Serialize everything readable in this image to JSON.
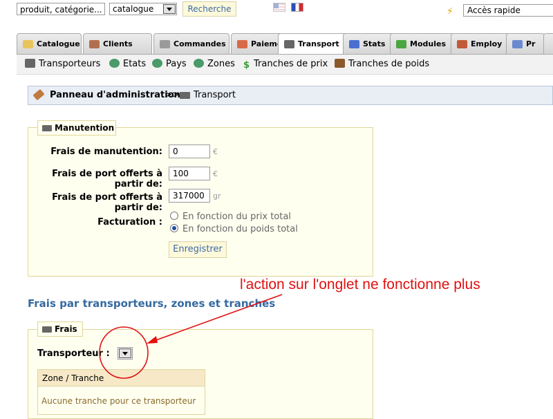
{
  "topbar": {
    "search_value": "produit, catégorie...",
    "category_select": "catalogue",
    "search_button": "Recherche",
    "flags": [
      "flag-us-icon",
      "flag-fr-icon"
    ],
    "quick_access": "Accès rapide"
  },
  "tabs": [
    {
      "label": "Catalogue",
      "icon": "folder-icon"
    },
    {
      "label": "Clients",
      "icon": "user-icon"
    },
    {
      "label": "Commandes",
      "icon": "cart-icon"
    },
    {
      "label": "Paiement",
      "icon": "payment-icon"
    },
    {
      "label": "Transport",
      "icon": "truck-icon",
      "active": true
    },
    {
      "label": "Stats",
      "icon": "chart-icon"
    },
    {
      "label": "Modules",
      "icon": "puzzle-icon"
    },
    {
      "label": "Employ",
      "icon": "employee-icon"
    },
    {
      "label": "Pr",
      "icon": "edit-icon"
    }
  ],
  "subnav": [
    {
      "label": "Transporteurs",
      "icon": "truck-icon"
    },
    {
      "label": "Etats",
      "icon": "globe-icon"
    },
    {
      "label": "Pays",
      "icon": "globe-icon"
    },
    {
      "label": "Zones",
      "icon": "globe-icon"
    },
    {
      "label": "Tranches de prix",
      "icon": "dollar-icon"
    },
    {
      "label": "Tranches de poids",
      "icon": "scale-icon"
    }
  ],
  "breadcrumb": {
    "root": "Panneau d'administration",
    "separator": ">>",
    "current": "Transport"
  },
  "handling": {
    "legend": "Manutention",
    "fields": [
      {
        "label": "Frais de manutention:",
        "value": "0",
        "unit": "€"
      },
      {
        "label_line1": "Frais de port offerts à",
        "label_line2": "partir de:",
        "value": "100",
        "unit": "€"
      },
      {
        "label_line1": "Frais de port offerts à",
        "label_line2": "partir de:",
        "value": "317000",
        "unit": "gr"
      }
    ],
    "billing_label": "Facturation :",
    "billing_options": [
      {
        "label": "En fonction du prix total",
        "checked": false
      },
      {
        "label": "En fonction du poids total",
        "checked": true
      }
    ],
    "save_button": "Enregistrer"
  },
  "fees": {
    "section_title": "Frais par transporteurs, zones et tranches",
    "legend": "Frais",
    "carrier_label": "Transporteur :",
    "table_header": "Zone / Tranche",
    "empty_message": "Aucune tranche pour ce transporteur"
  },
  "annotation": {
    "text": "l'action sur l'onglet ne fonctionne plus",
    "color": "#e21010"
  }
}
